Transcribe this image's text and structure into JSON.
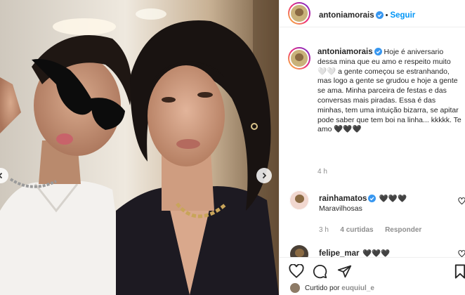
{
  "header": {
    "username": "antoniamorais",
    "separator": "•",
    "follow_label": "Seguir"
  },
  "caption": {
    "username": "antoniamorais",
    "text": "Hoje é aniversario dessa mina que eu amo e respeito muito 🤍🤍 a gente começou se estranhando, mas logo a gente se grudou e hoje a gente se ama. Minha parceira de festas e das conversas mais piradas. Essa é das minhas, tem uma intuição bizarra, se apitar pode saber que tem boi na linha... kkkkk. Te amo 🖤🖤🖤",
    "time": "4 h"
  },
  "comments": [
    {
      "username": "rainhamatos",
      "emoji": "🖤🖤🖤",
      "text": "Maravilhosas",
      "time": "3 h",
      "likes": "4 curtidas",
      "reply": "Responder"
    },
    {
      "username": "felipe_mar",
      "emoji": "🖤🖤🖤"
    }
  ],
  "footer": {
    "liked_prefix": "Curtido",
    "liked_by": "por",
    "liked_user": "euquiul_e"
  },
  "icons": {
    "verified": "verified-badge-icon",
    "heart": "heart-icon",
    "comment": "comment-icon",
    "share": "share-icon",
    "bookmark": "bookmark-icon",
    "more": "more-options-icon",
    "next": "chevron-right-icon",
    "prev": "chevron-left-icon"
  },
  "colors": {
    "follow_blue": "#0095f6",
    "verified_blue": "#3897f0",
    "muted": "#8e8e8e",
    "text": "#262626"
  }
}
